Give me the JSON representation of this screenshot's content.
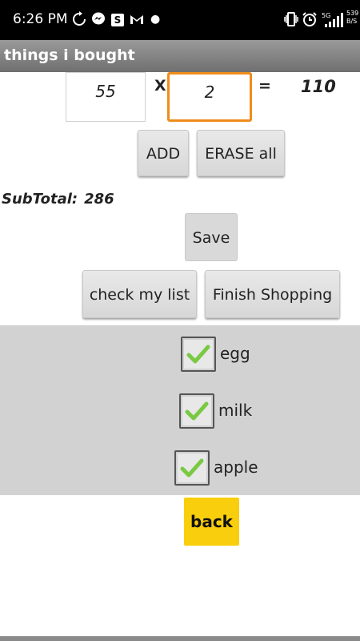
{
  "status_bar": {
    "time": "6:26 PM",
    "icons_left": [
      "sync-icon",
      "messenger-icon",
      "s-app-icon",
      "gmail-icon",
      "dot-icon"
    ],
    "icons_right": [
      "vibrate-icon",
      "alarm-icon",
      "signal-5g-icon"
    ],
    "network": "5G",
    "net_speed_value": "539",
    "net_speed_unit": "B/S"
  },
  "app_bar": {
    "title": "things i bought"
  },
  "calculator": {
    "price": "55",
    "multiply_sign": "X",
    "quantity": "2",
    "equals_sign": "=",
    "result": "110"
  },
  "buttons": {
    "add": "ADD",
    "erase_all": "ERASE all",
    "save": "Save",
    "check_my_list": "check my list",
    "finish_shopping": "Finish Shopping",
    "back": "back"
  },
  "subtotal": {
    "label": "SubTotal:",
    "value": "286"
  },
  "checklist": {
    "items": [
      {
        "label": "egg",
        "checked": true
      },
      {
        "label": "milk",
        "checked": true
      },
      {
        "label": "apple",
        "checked": true
      }
    ]
  },
  "colors": {
    "title_bar": "#808080",
    "focus_border": "#f08c1b",
    "back_button": "#f9ce0c",
    "check_mark": "#7ac943",
    "panel_bg": "#d2d2d2"
  }
}
